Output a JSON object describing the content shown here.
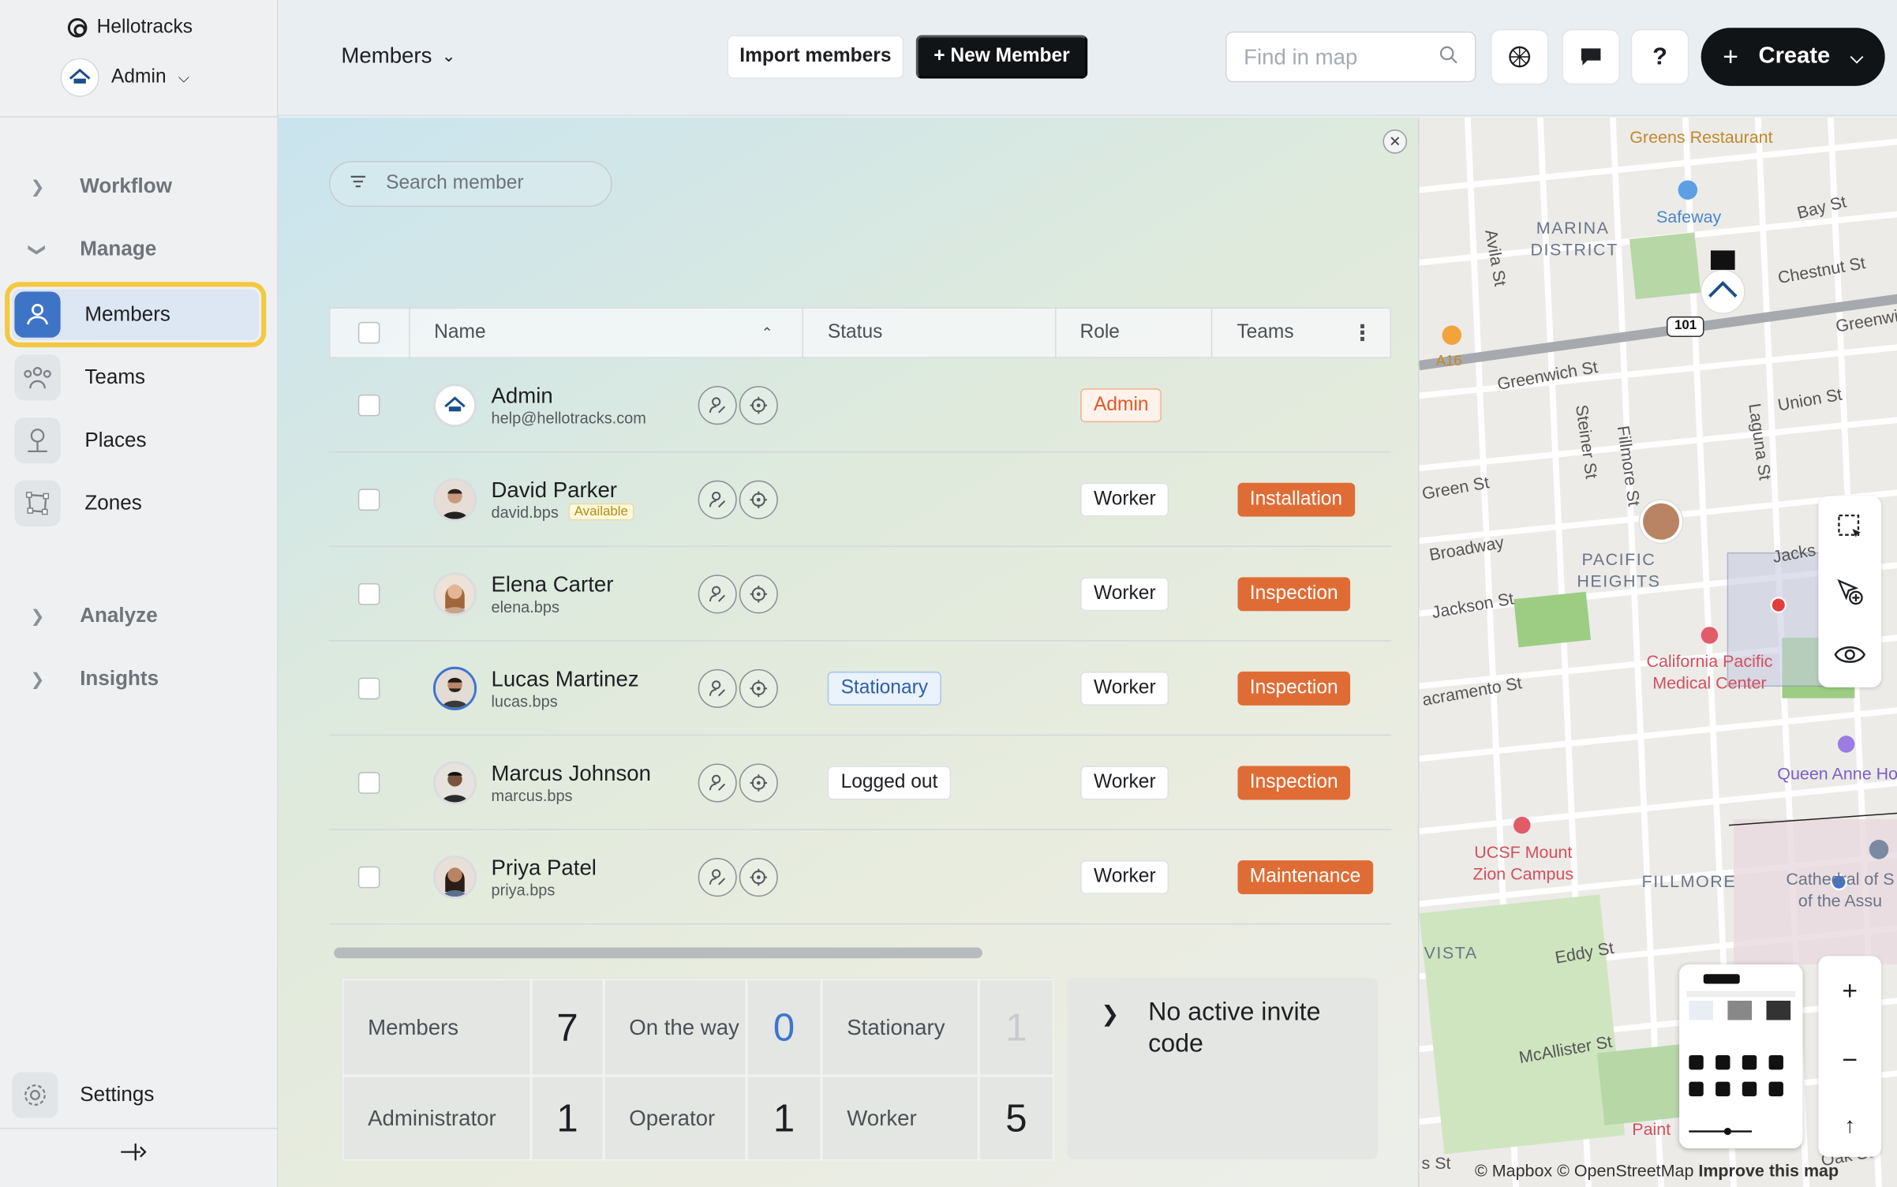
{
  "app": {
    "name": "Hellotracks",
    "account": "Admin"
  },
  "sidebar": {
    "groups": {
      "workflow": "Workflow",
      "manage": "Manage",
      "analyze": "Analyze",
      "insights": "Insights"
    },
    "items": [
      {
        "label": "Members"
      },
      {
        "label": "Teams"
      },
      {
        "label": "Places"
      },
      {
        "label": "Zones"
      }
    ],
    "settings": "Settings"
  },
  "topbar": {
    "crumb": "Members",
    "import_label": "Import members",
    "new_label": "+ New Member",
    "find_placeholder": "Find in map",
    "create_label": "Create",
    "help_label": "?"
  },
  "main": {
    "search_placeholder": "Search member",
    "columns": {
      "name": "Name",
      "status": "Status",
      "role": "Role",
      "teams": "Teams"
    },
    "rows": [
      {
        "name": "Admin",
        "email": "help@hellotracks.com",
        "status": "",
        "role": "Admin",
        "team": ""
      },
      {
        "name": "David Parker",
        "email": "david.bps",
        "badge": "Available",
        "status": "",
        "role": "Worker",
        "team": "Installation"
      },
      {
        "name": "Elena Carter",
        "email": "elena.bps",
        "status": "",
        "role": "Worker",
        "team": "Inspection"
      },
      {
        "name": "Lucas Martinez",
        "email": "lucas.bps",
        "status": "Stationary",
        "role": "Worker",
        "team": "Inspection"
      },
      {
        "name": "Marcus Johnson",
        "email": "marcus.bps",
        "status": "Logged out",
        "role": "Worker",
        "team": "Inspection"
      },
      {
        "name": "Priya Patel",
        "email": "priya.bps",
        "status": "",
        "role": "Worker",
        "team": "Maintenance"
      }
    ],
    "stats": {
      "members_label": "Members",
      "members_value": "7",
      "ontheway_label": "On the way",
      "ontheway_value": "0",
      "stationary_label": "Stationary",
      "stationary_value": "1",
      "admin_label": "Administrator",
      "admin_value": "1",
      "operator_label": "Operator",
      "operator_value": "1",
      "worker_label": "Worker",
      "worker_value": "5"
    },
    "invite": "No active invite code"
  },
  "map": {
    "labels": {
      "greens": "Greens Restaurant",
      "safeway": "Safeway",
      "marina": "MARINA DISTRICT",
      "bay": "Bay St",
      "chestnut": "Chestnut St",
      "avila": "Avila St",
      "greenwich": "Greenwich St",
      "greenwich2": "Greenwi",
      "union": "Union St",
      "steiner": "Steiner St",
      "fillmore": "Fillmore St",
      "laguna": "Laguna St",
      "green": "Green St",
      "broadway": "Broadway",
      "pacific": "PACIFIC HEIGHTS",
      "jackson": "Jackson St",
      "jacks": "Jacks",
      "cpmc": "California Pacific Medical Center",
      "sacramento": "acramento St",
      "queen": "Queen Anne Ho",
      "ucsf": "UCSF Mount Zion Campus",
      "fillmore2": "FILLMORE",
      "cathedral": "Cathedral of S of the Assu",
      "vista": "VISTA",
      "eddy": "Eddy St",
      "mcallister": "McAllister St",
      "paint": "Paint",
      "oak": "Oak St",
      "st": "s St",
      "a16": "A16",
      "hwy": "101"
    },
    "attribution": {
      "mapbox": "© Mapbox",
      "osm": "© OpenStreetMap",
      "improve": "Improve this map"
    }
  },
  "colors": {
    "accent": "#3e74c6",
    "team": "#e06c35",
    "highlight": "#f4c83f"
  }
}
